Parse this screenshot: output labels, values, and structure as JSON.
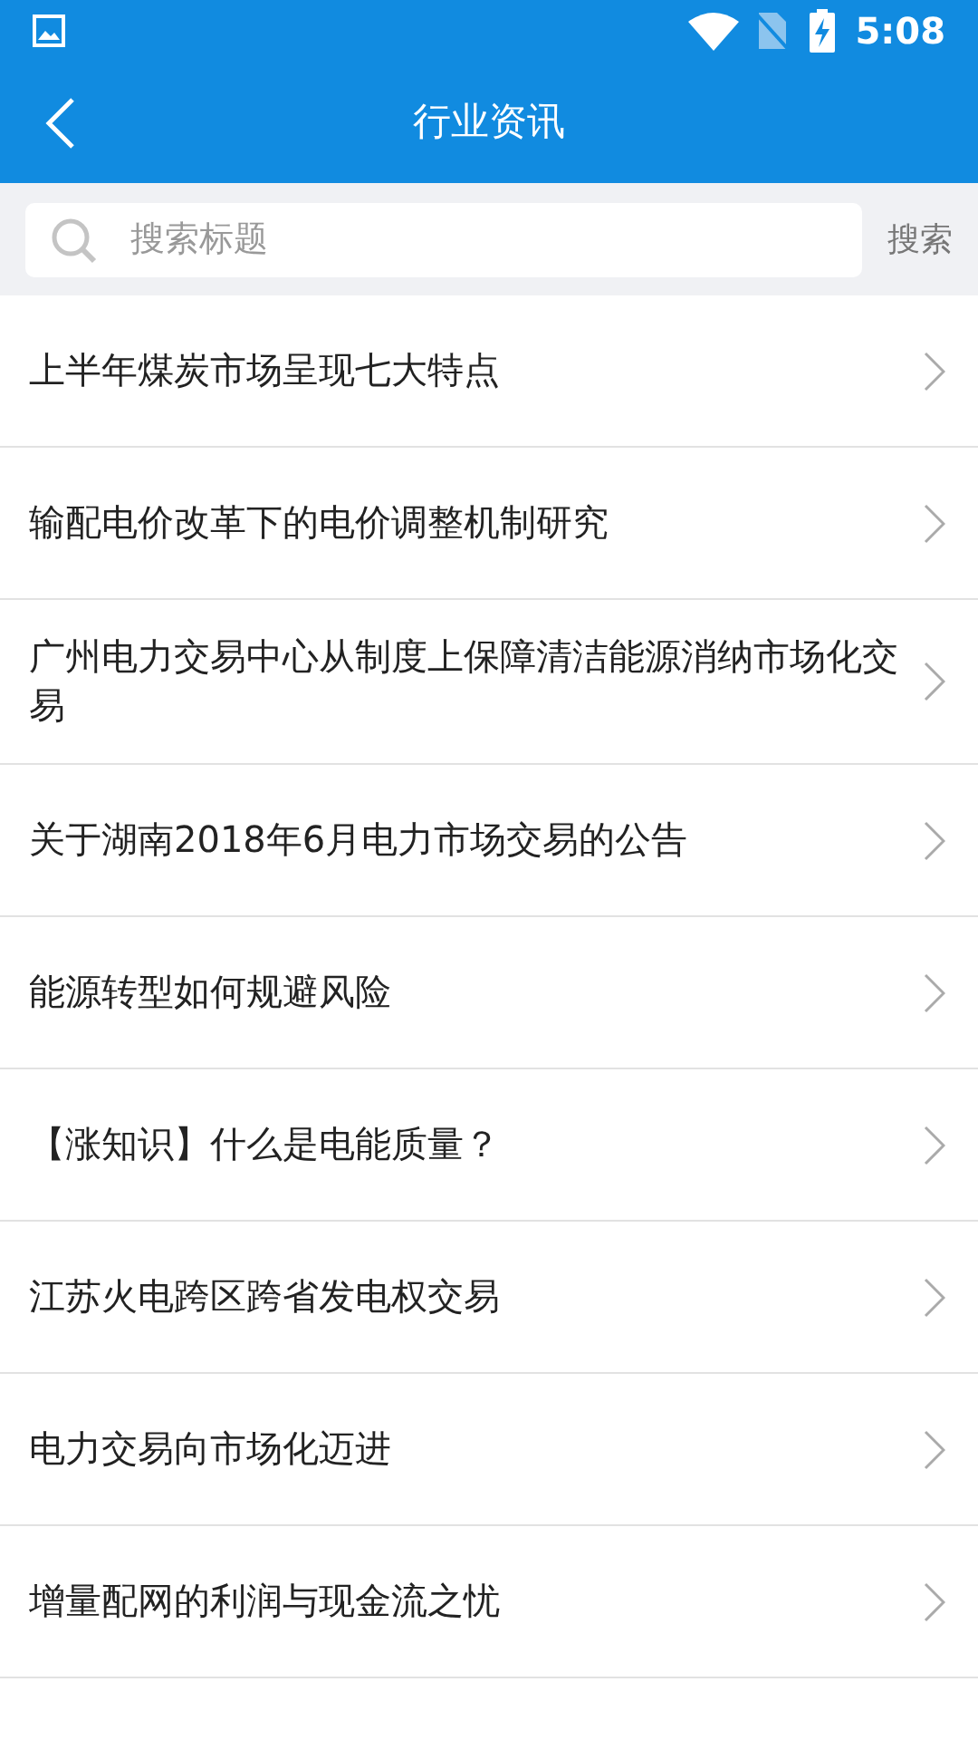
{
  "status_bar": {
    "time": "5:08"
  },
  "header": {
    "title": "行业资讯"
  },
  "search": {
    "placeholder": "搜索标题",
    "button": "搜索"
  },
  "articles": [
    {
      "title": "上半年煤炭市场呈现七大特点"
    },
    {
      "title": "输配电价改革下的电价调整机制研究"
    },
    {
      "title": "广州电力交易中心从制度上保障清洁能源消纳市场化交易"
    },
    {
      "title": "关于湖南2018年6月电力市场交易的公告"
    },
    {
      "title": "能源转型如何规避风险"
    },
    {
      "title": "【涨知识】什么是电能质量？"
    },
    {
      "title": "江苏火电跨区跨省发电权交易"
    },
    {
      "title": "电力交易向市场化迈进"
    },
    {
      "title": "增量配网的利润与现金流之忧"
    }
  ]
}
